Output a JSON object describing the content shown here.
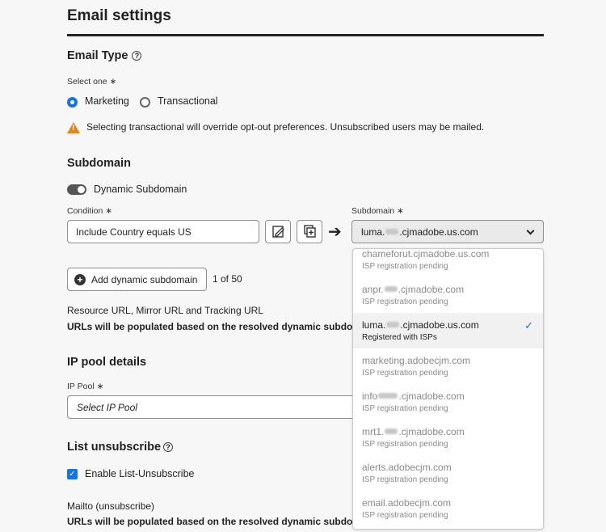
{
  "page": {
    "title": "Email settings"
  },
  "email_type": {
    "heading": "Email Type",
    "help_icon": "help-circle-icon",
    "select_label": "Select one ∗",
    "options": [
      {
        "label": "Marketing",
        "checked": true
      },
      {
        "label": "Transactional",
        "checked": false
      }
    ],
    "warning": "Selecting transactional will override opt-out preferences. Unsubscribed users may be mailed."
  },
  "subdomain": {
    "heading": "Subdomain",
    "dynamic_toggle_label": "Dynamic Subdomain",
    "condition_label": "Condition ∗",
    "condition_value": "Include Country equals US",
    "subdomain_label": "Subdomain ∗",
    "subdomain_prefix": "luma.",
    "subdomain_suffix": ".cjmadobe.us.com",
    "add_button": "Add dynamic subdomain",
    "count": "1 of 50",
    "resource_label": "Resource URL, Mirror URL and Tracking URL",
    "resource_note": "URLs will be populated based on the resolved dynamic subdoma"
  },
  "dropdown": {
    "options": [
      {
        "prefix": "chameforut.cjmadobe.us.com",
        "suffix": "",
        "status": "ISP registration pending",
        "selected": false
      },
      {
        "prefix": "anpr.",
        "suffix": ".cjmadobe.com",
        "status": "ISP registration pending",
        "selected": false
      },
      {
        "prefix": "luma.",
        "suffix": ".cjmadobe.us.com",
        "status": "Registered with ISPs",
        "selected": true
      },
      {
        "prefix": "marketing.adobecjm.com",
        "suffix": "",
        "status": "ISP registration pending",
        "selected": false
      },
      {
        "prefix": "info",
        "suffix": ".cjmadobe.com",
        "status": "ISP registration pending",
        "selected": false
      },
      {
        "prefix": "mrt1.",
        "suffix": ".cjmadobe.com",
        "status": "ISP registration pending",
        "selected": false
      },
      {
        "prefix": "alerts.adobecjm.com",
        "suffix": "",
        "status": "ISP registration pending",
        "selected": false
      },
      {
        "prefix": "email.adobecjm.com",
        "suffix": "",
        "status": "ISP registration pending",
        "selected": false
      }
    ]
  },
  "ip_pool": {
    "heading": "IP pool details",
    "label": "IP Pool ∗",
    "placeholder": "Select IP Pool"
  },
  "list_unsubscribe": {
    "heading": "List unsubscribe",
    "checkbox_label": "Enable List-Unsubscribe",
    "checked": true,
    "mailto_label": "Mailto (unsubscribe)",
    "mailto_note": "URLs will be populated based on the resolved dynamic subdoma"
  }
}
